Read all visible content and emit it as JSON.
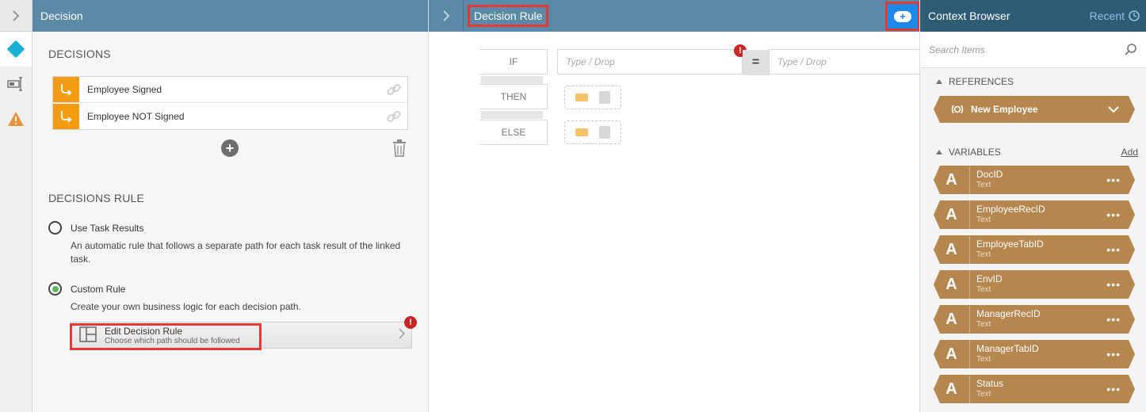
{
  "left_rail": {
    "expand_icon": "chevron-right-icon",
    "items": [
      {
        "icon": "diamond-icon",
        "active": true
      },
      {
        "icon": "form-field-icon",
        "active": false
      },
      {
        "icon": "warning-icon",
        "active": false
      }
    ]
  },
  "decision_panel": {
    "title": "Decision",
    "decisions_heading": "DECISIONS",
    "decisions": [
      {
        "label": "Employee Signed"
      },
      {
        "label": "Employee NOT Signed"
      }
    ],
    "rule_heading": "DECISIONS RULE",
    "options": [
      {
        "label": "Use Task Results",
        "description": "An automatic rule that follows a separate path for each task result of the linked task.",
        "selected": false
      },
      {
        "label": "Custom Rule",
        "description": "Create your own business logic for each decision path.",
        "selected": true
      }
    ],
    "edit_button": {
      "title": "Edit Decision Rule",
      "subtitle": "Choose which path should be followed"
    },
    "error_glyph": "!"
  },
  "rule_panel": {
    "title": "Decision Rule",
    "if_label": "IF",
    "then_label": "THEN",
    "else_label": "ELSE",
    "left_placeholder": "Type / Drop",
    "right_placeholder": "Type / Drop",
    "operator": "="
  },
  "context_browser": {
    "title": "Context Browser",
    "recent_label": "Recent",
    "search_placeholder": "Search Items",
    "references_heading": "REFERENCES",
    "references": [
      {
        "label": "New Employee"
      }
    ],
    "variables_heading": "VARIABLES",
    "add_label": "Add",
    "variables": [
      {
        "glyph": "A",
        "name": "DocID",
        "type": "Text"
      },
      {
        "glyph": "A",
        "name": "EmployeeRecID",
        "type": "Text"
      },
      {
        "glyph": "A",
        "name": "EmployeeTabID",
        "type": "Text"
      },
      {
        "glyph": "A",
        "name": "EnvID",
        "type": "Text"
      },
      {
        "glyph": "A",
        "name": "ManagerRecID",
        "type": "Text"
      },
      {
        "glyph": "A",
        "name": "ManagerTabID",
        "type": "Text"
      },
      {
        "glyph": "A",
        "name": "Status",
        "type": "Text"
      }
    ],
    "more_glyph": "•••"
  },
  "colors": {
    "header": "#5b8aa6",
    "context_header": "#2f5c75",
    "decision_orange": "#f39c12",
    "variable_tan": "#b5874f",
    "highlight_red": "#e53935",
    "accent_blue": "#1e88e5"
  }
}
